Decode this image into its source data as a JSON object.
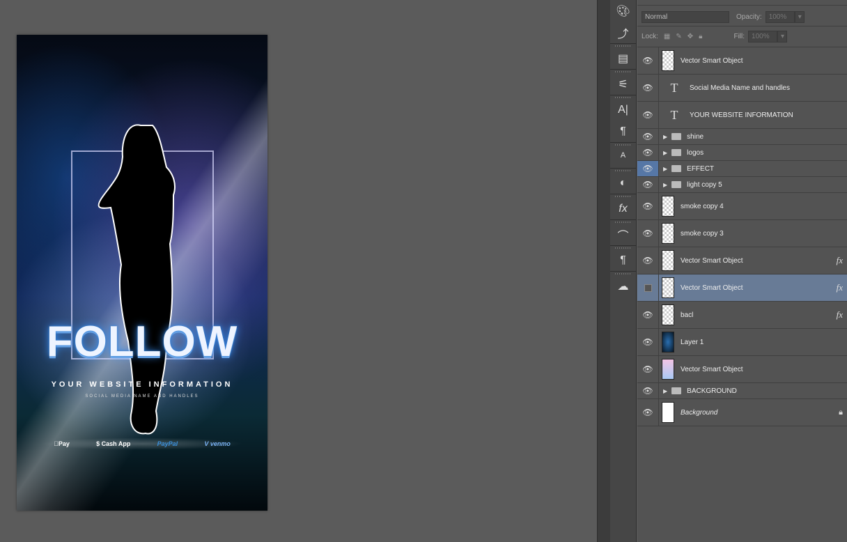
{
  "document": {
    "headline": "FOLLOW",
    "website": "YOUR WEBSITE INFORMATION",
    "social": "SOCIAL MEDIA NAME AND HANDLES",
    "payments": [
      "Pay",
      "$ Cash App",
      "PayPal",
      "V venmo"
    ]
  },
  "layers_panel": {
    "blend_mode": "Normal",
    "opacity_label": "Opacity:",
    "opacity": "100%",
    "lock_label": "Lock:",
    "fill_label": "Fill:",
    "fill": "100%",
    "layers": [
      {
        "name": "Vector Smart Object",
        "type": "smart"
      },
      {
        "name": "Social Media Name and handles",
        "type": "text"
      },
      {
        "name": "YOUR WEBSITE INFORMATION",
        "type": "text"
      },
      {
        "name": "shine",
        "type": "group"
      },
      {
        "name": "logos",
        "type": "group"
      },
      {
        "name": "EFFECT",
        "type": "group"
      },
      {
        "name": "light copy 5",
        "type": "group"
      },
      {
        "name": "smoke copy 4",
        "type": "pixel"
      },
      {
        "name": "smoke copy 3",
        "type": "pixel"
      },
      {
        "name": "Vector Smart Object",
        "type": "smart",
        "fx": "fx"
      },
      {
        "name": "Vector Smart Object",
        "type": "smart",
        "fx": "fx",
        "selected": true
      },
      {
        "name": "bacl",
        "type": "smart",
        "fx": "fx"
      },
      {
        "name": "Layer 1",
        "type": "pixel"
      },
      {
        "name": "Vector Smart Object",
        "type": "smart"
      },
      {
        "name": "BACKGROUND",
        "type": "group"
      },
      {
        "name": "Background",
        "type": "background"
      }
    ]
  },
  "tools": [
    "palette-icon",
    "history-icon",
    "properties-icon",
    "brush-presets-icon",
    "character-icon",
    "paragraph-icon",
    "character-styles-icon",
    "adjustments-icon",
    "styles-icon",
    "paths-icon",
    "paragraph-styles-icon",
    "channels-icon"
  ]
}
